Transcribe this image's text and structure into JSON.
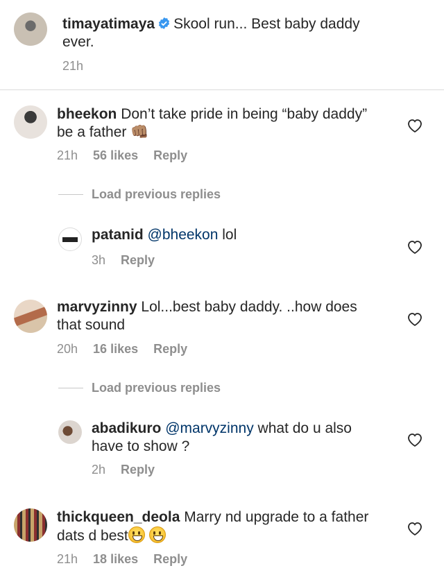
{
  "caption": {
    "username": "timayatimaya",
    "text": "Skool run... Best baby daddy ever.",
    "time": "21h"
  },
  "comments": [
    {
      "username": "bheekon",
      "text": "Don’t take pride in being “baby daddy” be a father 👊🏽",
      "time": "21h",
      "likes": "56 likes",
      "reply": "Reply",
      "load_more": "Load previous replies",
      "reply_item": {
        "username": "patanid",
        "mention": "@bheekon",
        "text": " lol",
        "time": "3h",
        "reply": "Reply"
      }
    },
    {
      "username": "marvyzinny",
      "text": "Lol...best baby daddy. ..how does that sound",
      "time": "20h",
      "likes": "16 likes",
      "reply": "Reply",
      "load_more": "Load previous replies",
      "reply_item": {
        "username": "abadikuro",
        "mention": "@marvyzinny",
        "text": " what do u also have to show ?",
        "time": "2h",
        "reply": "Reply"
      }
    },
    {
      "username": "thickqueen_deola",
      "text": "Marry nd upgrade to a father dats d best",
      "time": "21h",
      "likes": "18 likes",
      "reply": "Reply"
    }
  ],
  "icons": {
    "verified": "verified-badge-icon",
    "like": "heart-outline-icon"
  },
  "colors": {
    "verified": "#3897f0",
    "mention": "#003569",
    "meta": "#8e8e8e"
  }
}
